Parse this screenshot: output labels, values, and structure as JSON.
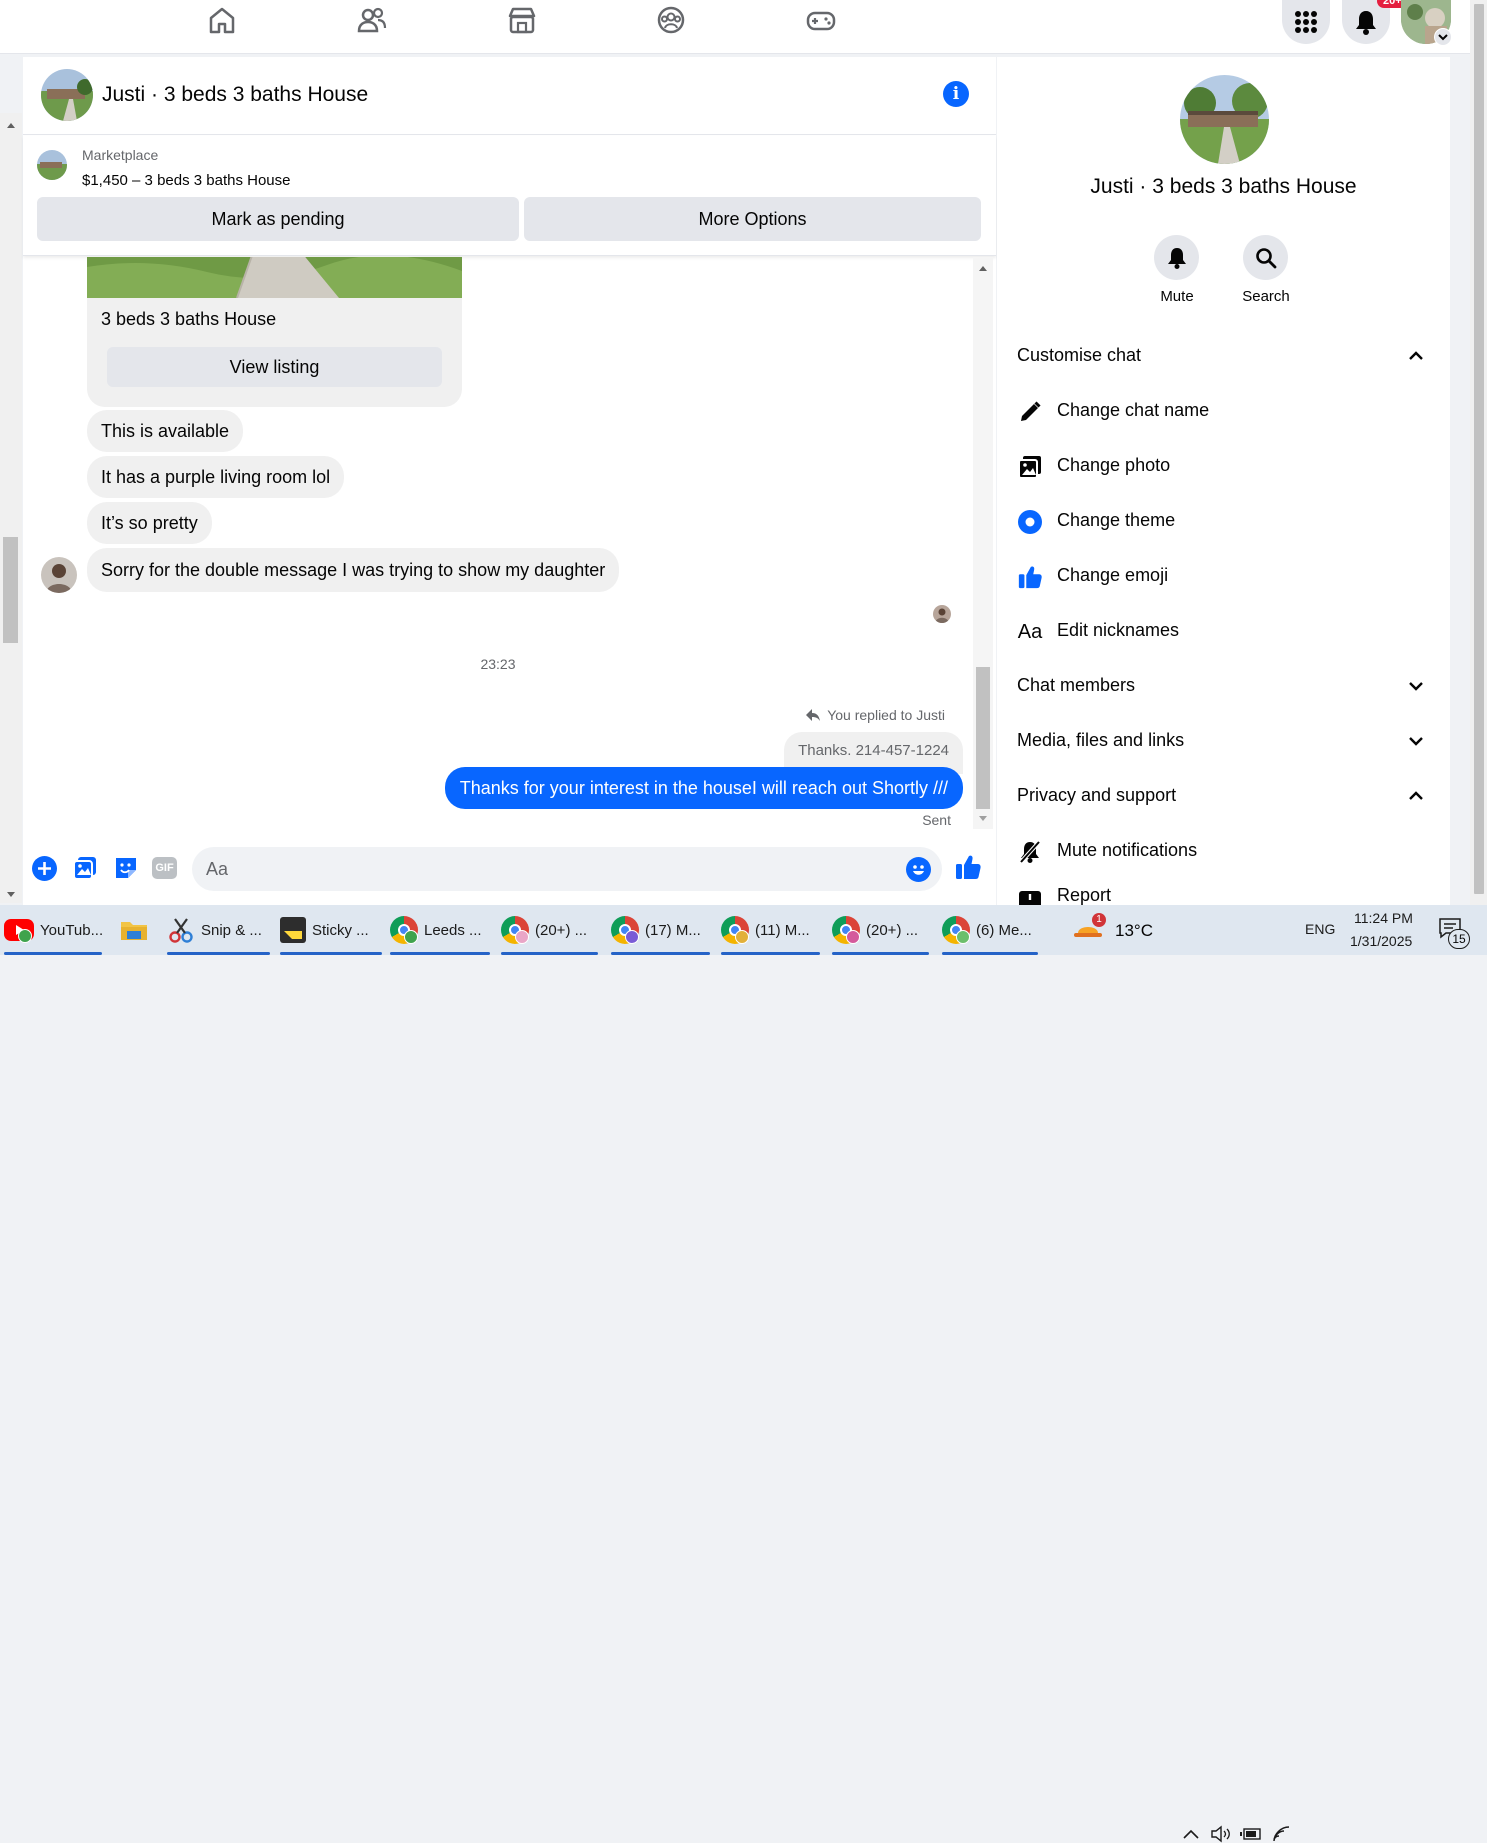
{
  "colors": {
    "accent": "#0866ff",
    "bubble": "#f0f0f0",
    "button_bg": "#e4e6eb",
    "notif": "#e41e3f"
  },
  "topnav": {
    "icons": [
      "home-icon",
      "friends-icon",
      "marketplace-icon",
      "groups-icon",
      "gaming-icon"
    ],
    "notification_badge": "20+"
  },
  "chat": {
    "title": "Justi · 3 beds 3 baths House",
    "marketplace": {
      "label": "Marketplace",
      "listing": "$1,450 – 3 beds 3 baths House",
      "pending_button": "Mark as pending",
      "options_button": "More Options"
    },
    "card": {
      "title": "3 beds 3 baths House",
      "button": "View listing"
    },
    "messages": [
      "This is available",
      "It has a purple living room lol",
      "It’s so pretty",
      "Sorry for the double message I was trying to show my daughter"
    ],
    "timestamp": "23:23",
    "reply_note": "You replied to Justi",
    "quoted": "Thanks. 214-457-1224",
    "sent_message": "Thanks for your interest in the houseI will reach out Shortly ///",
    "sent_status": "Sent",
    "composer": {
      "placeholder": "Aa",
      "gif_label": "GIF"
    }
  },
  "info_panel": {
    "title": "Justi · 3 beds 3 baths House",
    "mute_label": "Mute",
    "search_label": "Search",
    "customise": "Customise chat",
    "change_chat_name": "Change chat name",
    "change_photo": "Change photo",
    "change_theme": "Change theme",
    "change_emoji": "Change emoji",
    "nickname_glyph": "Aa",
    "edit_nicknames": "Edit nicknames",
    "chat_members": "Chat members",
    "media": "Media, files and links",
    "privacy": "Privacy and support",
    "mute_notifications": "Mute notifications",
    "report": "Report"
  },
  "taskbar": {
    "apps": [
      "YouTub...",
      "",
      "Snip & ...",
      "Sticky ...",
      "Leeds ...",
      "(20+) ...",
      "(17) M...",
      "(11) M...",
      "(20+) ...",
      "(6) Me..."
    ],
    "weather_badge": "1",
    "temperature": "13°C",
    "language": "ENG",
    "time": "11:24 PM",
    "date": "1/31/2025",
    "notifications": "15"
  }
}
